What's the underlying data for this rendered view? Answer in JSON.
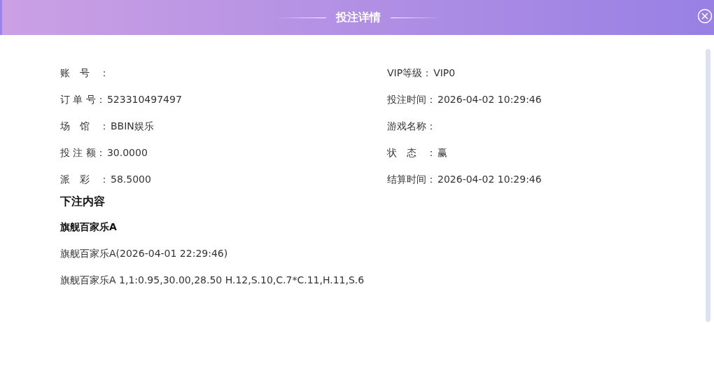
{
  "window": {
    "title": "投注详情"
  },
  "left_fields": [
    {
      "label": "账　号　："
    },
    {
      "label": "订 单 号：",
      "value": "523310497497"
    },
    {
      "label": "场　馆　：",
      "value": "BBIN娱乐"
    },
    {
      "label": "投 注 额：",
      "value": "30.0000"
    },
    {
      "label": "派　彩　：",
      "value": "58.5000"
    }
  ],
  "right_fields": [
    {
      "label": "VIP等级：",
      "value": "VIP0"
    },
    {
      "label": "投注时间：",
      "value": "2026-04-02 10:29:46"
    },
    {
      "label": "游戏名称："
    },
    {
      "label": "状　态　：",
      "value": "赢"
    },
    {
      "label": "结算时间：",
      "value": "2026-04-02 10:29:46"
    }
  ],
  "bet_content": {
    "heading": "下注内容",
    "game": "旗舰百家乐A",
    "lines": [
      "旗舰百家乐A(2026-04-01 22:29:46)",
      "旗舰百家乐A 1,1:0.95,30.00,28.50 H.12,S.10,C.7*C.11,H.11,S.6"
    ]
  }
}
